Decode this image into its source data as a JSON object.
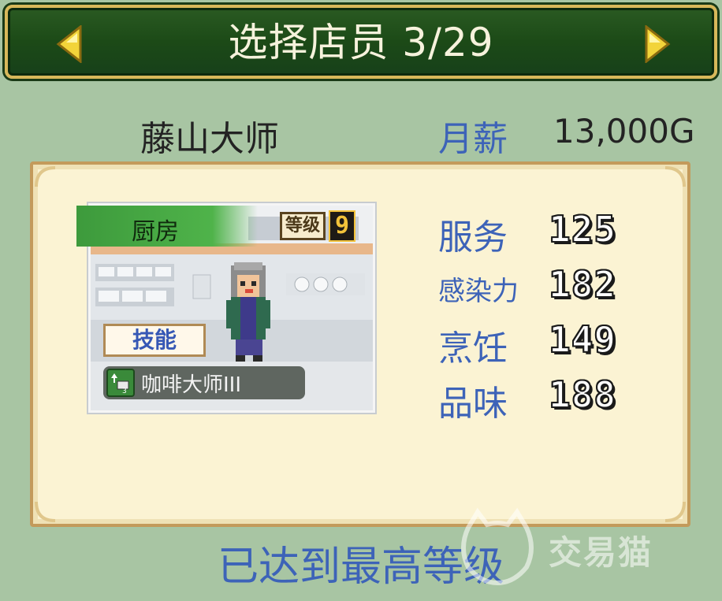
{
  "header": {
    "title": "选择店员 3/29",
    "prev_icon": "triangle-left-icon",
    "next_icon": "triangle-right-icon",
    "arrow_color": "#f2d43a"
  },
  "staff": {
    "name": "藤山大师",
    "salary_label": "月薪",
    "salary_value": "13,000G"
  },
  "card": {
    "department": "厨房",
    "level_label": "等级",
    "level_value": "9",
    "skill_tag": "技能",
    "skill_name": "咖啡大师III",
    "skill_icon": "cup-upgrade-icon"
  },
  "stats": [
    {
      "label": "服务",
      "value": "125"
    },
    {
      "label": "感染力",
      "value": "182"
    },
    {
      "label": "烹饪",
      "value": "149"
    },
    {
      "label": "品味",
      "value": "188"
    }
  ],
  "footer": {
    "text": "已达到最高等级"
  },
  "watermark": {
    "text": "交易猫"
  },
  "colors": {
    "accent_blue": "#3d63b8",
    "background": "#a8c5a3",
    "panel": "#fbf3d3"
  }
}
